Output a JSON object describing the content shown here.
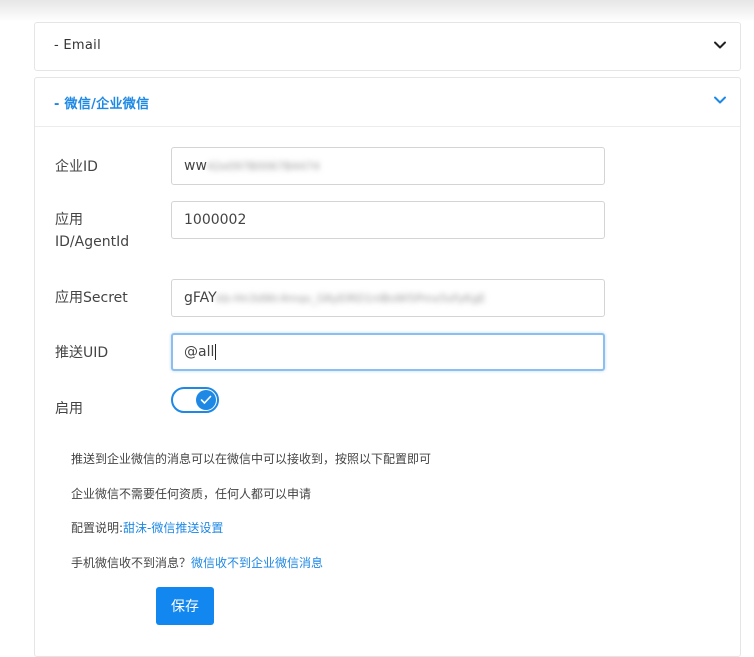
{
  "email_panel": {
    "title": "- Email",
    "chevron_icon": "chevron-down-icon"
  },
  "wechat_panel": {
    "title": "- 微信/企业微信",
    "chevron_icon": "chevron-down-icon",
    "accent_color": "#1e88e5",
    "fields": {
      "corp_id": {
        "label": "企业ID",
        "value_visible": "ww",
        "value_blurred": "42e097B0067B4474"
      },
      "agent_id": {
        "label_line1": "应用",
        "label_line2": "ID/AgentId",
        "value": "1000002"
      },
      "secret": {
        "label": "应用Secret",
        "value_visible": "gFAY",
        "value_blurred": "kb-Hn3dWc4mqv_GKyEIRD1nlBsWl5Pmx5sFyKgE"
      },
      "push_uid": {
        "label": "推送UID",
        "value": "@all"
      },
      "enable": {
        "label": "启用",
        "checked": true
      }
    },
    "notes": {
      "line1": "推送到企业微信的消息可以在微信中可以接收到，按照以下配置即可",
      "line2": "企业微信不需要任何资质，任何人都可以申请",
      "line3_prefix": "配置说明:",
      "line3_link": "甜沫-微信推送设置",
      "line4_prefix": "手机微信收不到消息？",
      "line4_link": "微信收不到企业微信消息"
    },
    "save_label": "保存",
    "save_color": "#1187ef"
  }
}
